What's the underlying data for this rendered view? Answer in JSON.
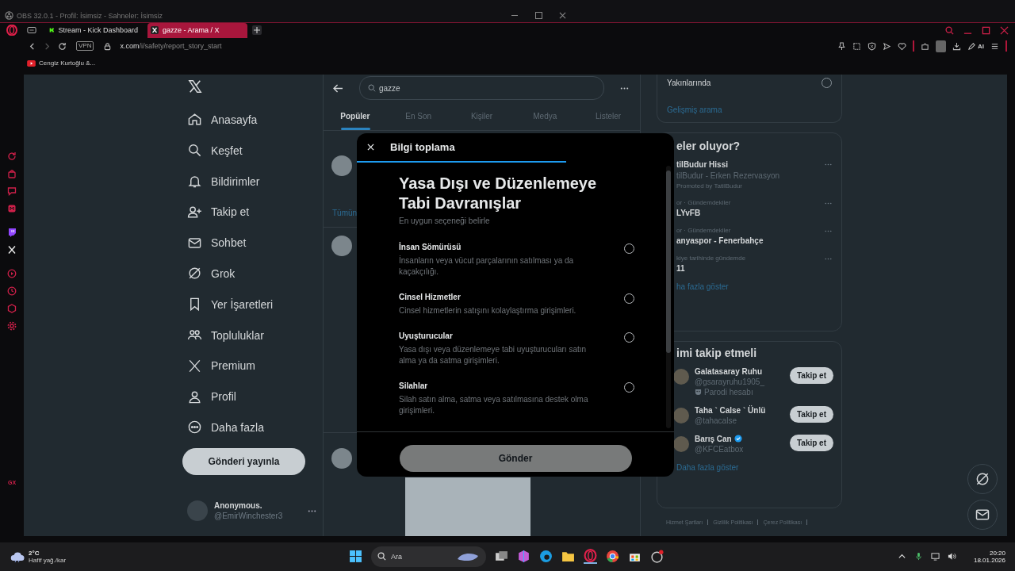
{
  "obs_title": "OBS 32.0.1 - Profil: İsimsiz - Sahneler: İsimsiz",
  "browser": {
    "tabs": [
      {
        "title": "Stream - Kick Dashboard",
        "selected": false,
        "kind": "kick"
      },
      {
        "title": "gazze - Arama / X",
        "selected": true,
        "kind": "x"
      }
    ],
    "vpn": "VPN",
    "url_host": "x.com",
    "url_path": "/i/safety/report_story_start",
    "ai_label": "AI",
    "bookmarks": [
      "Cengiz Kurtoğlu &..."
    ],
    "sidebar_badge": "GX"
  },
  "nav": {
    "items": [
      {
        "label": "Anasayfa",
        "kind": "home"
      },
      {
        "label": "Keşfet",
        "kind": "explore"
      },
      {
        "label": "Bildirimler",
        "kind": "notifications"
      },
      {
        "label": "Takip et",
        "kind": "follow"
      },
      {
        "label": "Sohbet",
        "kind": "chat"
      },
      {
        "label": "Grok",
        "kind": "grok"
      },
      {
        "label": "Yer İşaretleri",
        "kind": "bookmarks"
      },
      {
        "label": "Topluluklar",
        "kind": "communities"
      },
      {
        "label": "Premium",
        "kind": "premium"
      },
      {
        "label": "Profil",
        "kind": "profile"
      },
      {
        "label": "Daha fazla",
        "kind": "more"
      }
    ],
    "post_button": "Gönderi yayınla",
    "account": {
      "name": "Anonymous.",
      "handle": "@EmirWinchester3"
    }
  },
  "search": {
    "value": "gazze",
    "tabs": [
      {
        "label": "Popüler",
        "selected": true
      },
      {
        "label": "En Son",
        "selected": false
      },
      {
        "label": "Kişiler",
        "selected": false
      },
      {
        "label": "Medya",
        "selected": false
      },
      {
        "label": "Listeler",
        "selected": false
      }
    ],
    "partial_link": "Tümün"
  },
  "modal": {
    "title": "Bilgi toplama",
    "progress": {
      "level": 0.66
    },
    "heading": "Yasa Dışı ve Düzenlemeye Tabi Davranışlar",
    "subheading": "En uygun seçeneği belirle",
    "options": [
      {
        "title": "İnsan Sömürüsü",
        "description": "İnsanların veya vücut parçalarının satılması ya da kaçakçılığı.",
        "selected": false
      },
      {
        "title": "Cinsel Hizmetler",
        "description": "Cinsel hizmetlerin satışını kolaylaştırma girişimleri.",
        "selected": false
      },
      {
        "title": "Uyuşturucular",
        "description": "Yasa dışı veya düzenlemeye tabi uyuşturucuları satın alma ya da satma girişimleri.",
        "selected": false
      },
      {
        "title": "Silahlar",
        "description": "Silah satın alma, satma veya satılmasına destek olma girişimleri.",
        "selected": false
      }
    ],
    "submit": {
      "label": "Gönder",
      "disabled": true
    }
  },
  "right": {
    "nearby": {
      "label": "Yakınlarında",
      "selected": false
    },
    "advanced_search": "Gelişmiş arama",
    "trends_title": "eler oluyor?",
    "trends": [
      {
        "name": "tilBudur Hissi",
        "subtitle": "tilBudur - Erken Rezervasyon",
        "promoted": "Promoted by TatilBudur"
      },
      {
        "context": "or · Gündemdekiler",
        "name": "LYvFB"
      },
      {
        "context": "or · Gündemdekiler",
        "name": "anyaspor - Fenerbahçe"
      },
      {
        "context": "kiye tarihinde gündemde",
        "name": "11"
      }
    ],
    "trends_more": "ha fazla göster",
    "follow_title": "imi takip etmeli",
    "people": [
      {
        "name": "Galatasaray Ruhu",
        "handle": "@gsarayruhu1905_",
        "label": "Parodi hesabı",
        "verified": false,
        "button": "Takip et"
      },
      {
        "name": "Taha ` Calse ` Ünlü",
        "handle": "@tahacalse",
        "verified": false,
        "button": "Takip et"
      },
      {
        "name": "Barış Can",
        "handle": "@KFCEatbox",
        "verified": true,
        "button": "Takip et"
      }
    ],
    "follow_more": "Daha fazla göster",
    "footer_links": [
      "Hizmet Şartları",
      "Gizlilik Politikası",
      "Çerez Politikası"
    ]
  },
  "taskbar": {
    "temperature": "2°C",
    "weather": "Hafif yağ./kar",
    "search_placeholder": "Ara",
    "time": "20:20",
    "date": "18.01.2026"
  }
}
